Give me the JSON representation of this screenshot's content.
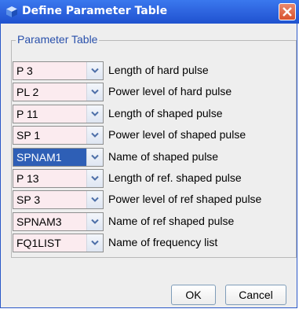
{
  "window": {
    "title": "Define Parameter Table",
    "icon": "app-cube-icon",
    "close_icon": "close-icon"
  },
  "group": {
    "legend": "Parameter Table"
  },
  "rows": [
    {
      "value": "P 3",
      "label": "Length of hard pulse",
      "selected": false
    },
    {
      "value": "PL 2",
      "label": "Power level of hard pulse",
      "selected": false
    },
    {
      "value": "P 11",
      "label": "Length of shaped pulse",
      "selected": false
    },
    {
      "value": "SP 1",
      "label": "Power level of shaped pulse",
      "selected": false
    },
    {
      "value": "SPNAM1",
      "label": "Name of shaped pulse",
      "selected": true
    },
    {
      "value": "P 13",
      "label": "Length of ref. shaped pulse",
      "selected": false
    },
    {
      "value": "SP 3",
      "label": "Power level of ref shaped pulse",
      "selected": false
    },
    {
      "value": "SPNAM3",
      "label": "Name of ref shaped pulse",
      "selected": false
    },
    {
      "value": "FQ1LIST",
      "label": "Name of frequency list",
      "selected": false
    }
  ],
  "buttons": {
    "ok": "OK",
    "cancel": "Cancel"
  },
  "colors": {
    "titlebar": "#2f66e0",
    "field_bg": "#fbebef",
    "selected_bg": "#2e5fb6",
    "legend_text": "#2950ab"
  }
}
